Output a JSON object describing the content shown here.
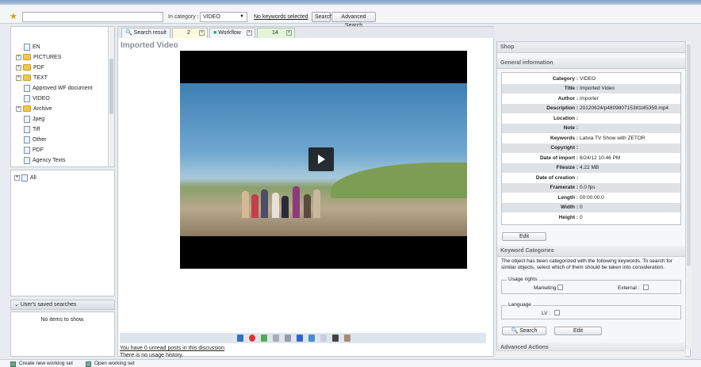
{
  "toolbar": {
    "search_value": "",
    "category_label": "In category :",
    "category_value": "VIDEO",
    "no_keywords_label": "No keywords selected",
    "search_button": "Search",
    "advanced_search_button": "Advanced Search"
  },
  "tree": {
    "items": [
      {
        "label": "EN",
        "type": "doc"
      },
      {
        "label": "PICTURES",
        "type": "folder"
      },
      {
        "label": "PDF",
        "type": "folder"
      },
      {
        "label": "TEXT",
        "type": "folder"
      },
      {
        "label": "Approved WF document",
        "type": "doc"
      },
      {
        "label": "VIDEO",
        "type": "doc"
      },
      {
        "label": "Archive",
        "type": "folder"
      },
      {
        "label": "Jpeg",
        "type": "doc"
      },
      {
        "label": "Tiff",
        "type": "doc"
      },
      {
        "label": "Other",
        "type": "doc"
      },
      {
        "label": "PDF",
        "type": "doc"
      },
      {
        "label": "Agency Texts",
        "type": "doc"
      }
    ],
    "all_label": "All"
  },
  "saved_searches": {
    "header": "User's saved searches",
    "empty_text": "No items to show."
  },
  "tabs": [
    {
      "label": "Search result"
    },
    {
      "label": "2"
    },
    {
      "label": "Workflow"
    },
    {
      "label": "14"
    }
  ],
  "main": {
    "title": "Imported Video",
    "posts_link": "You have 0 unread posts in this discussion",
    "usage_text": "There is no usage history."
  },
  "right": {
    "shop_header": "Shop",
    "general_header": "General information",
    "info": [
      {
        "k": "Category :",
        "v": "VIDEO"
      },
      {
        "k": "Title :",
        "v": "Imported Video"
      },
      {
        "k": "Author :",
        "v": "importer"
      },
      {
        "k": "Description :",
        "v": "20120624/p480980715381t45359.mp4"
      },
      {
        "k": "Location :",
        "v": ""
      },
      {
        "k": "Note :",
        "v": ""
      },
      {
        "k": "Keywords :",
        "v": "Latvia TV Show with ZETOR"
      },
      {
        "k": "Copyright :",
        "v": ""
      },
      {
        "k": "Date of import :",
        "v": "6/24/12 10:46 PM"
      },
      {
        "k": "Filesize :",
        "v": "4.22 MB"
      },
      {
        "k": "Date of creation :",
        "v": ""
      },
      {
        "k": "Framerate :",
        "v": "0.0 fps"
      },
      {
        "k": "Length :",
        "v": "00:00:00.0"
      },
      {
        "k": "Width :",
        "v": "0"
      },
      {
        "k": "Height :",
        "v": "0"
      }
    ],
    "edit_label": "Edit",
    "keyword_header": "Keyword Categories",
    "keyword_text": "The object has been categorized with the following keywords. To search for similar objects, select which of them should be taken into consideration.",
    "usage_rights_legend": "Usage rights",
    "marketing_label": "Marketing :",
    "external_label": "External :",
    "language_legend": "Language",
    "lv_label": "LV :",
    "search_label": "Search",
    "edit2_label": "Edit",
    "advanced_header": "Advanced Actions"
  },
  "status": {
    "create_label": "Create new working set",
    "open_label": "Open working set"
  }
}
